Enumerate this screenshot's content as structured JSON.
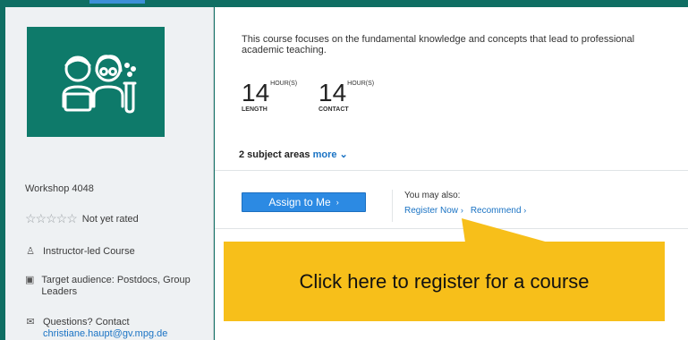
{
  "course": {
    "description": "This course focuses on the fundamental knowledge and concepts that lead to professional academic teaching.",
    "length_value": "14",
    "length_unit": "HOUR(S)",
    "length_label": "LENGTH",
    "contact_value": "14",
    "contact_unit": "HOUR(S)",
    "contact_label": "CONTACT",
    "subjects_text": "2 subject areas",
    "more_label": "more"
  },
  "sidebar": {
    "workshop": "Workshop 4048",
    "rating_text": "Not yet rated",
    "stars": "☆☆☆☆☆",
    "delivery": "Instructor-led Course",
    "audience": "Target audience: Postdocs, Group Leaders",
    "contact_prefix": "Questions? Contact",
    "contact_email": "christiane.haupt@gv.mpg.de"
  },
  "actions": {
    "assign_label": "Assign to Me",
    "also_label": "You may also:",
    "register_label": "Register Now",
    "recommend_label": "Recommend"
  },
  "callout": {
    "text": "Click here to register for a course"
  },
  "colors": {
    "background": "#0f6e63",
    "accent": "#2c8ae3",
    "callout": "#f7bf1a"
  }
}
